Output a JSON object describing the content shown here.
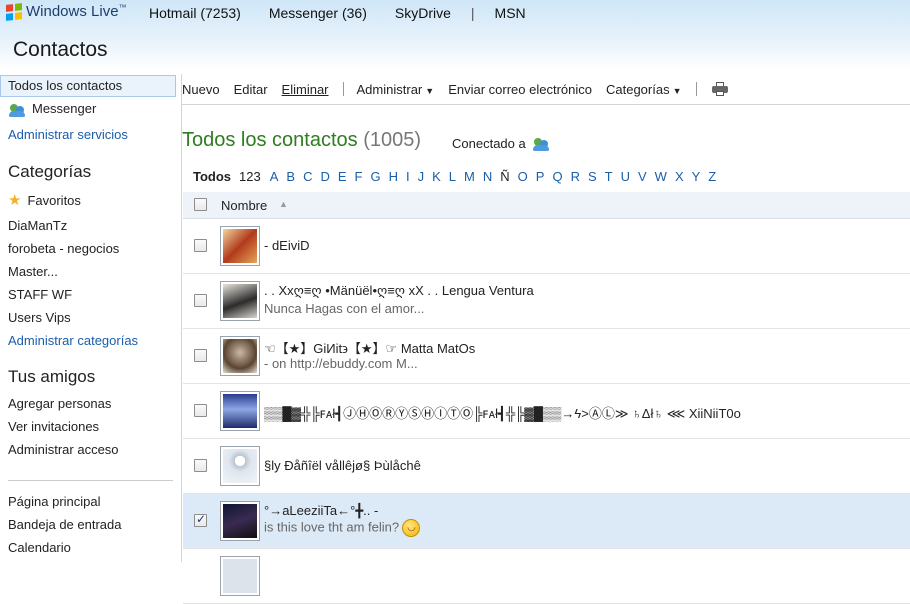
{
  "topbar": {
    "brand": "Windows Live",
    "brand_mark": "™",
    "nav": [
      "Hotmail (7253)",
      "Messenger (36)",
      "SkyDrive"
    ],
    "nav_sep": "|",
    "nav_last": "MSN",
    "flag_colors": [
      "#e8452c",
      "#7cbb00",
      "#00a1f1",
      "#ffbb00"
    ]
  },
  "page_title": "Contactos",
  "sidebar": {
    "all_contacts": "Todos los contactos",
    "messenger": "Messenger",
    "manage_services": "Administrar servicios",
    "categories_head": "Categorías",
    "favorites": "Favoritos",
    "categories": [
      "DiaManTz",
      "forobeta - negocios",
      "Master...",
      "STAFF WF",
      "Users Vips"
    ],
    "manage_categories": "Administrar categorías",
    "friends_head": "Tus amigos",
    "add_people": "Agregar personas",
    "view_invites": "Ver invitaciones",
    "manage_access": "Administrar acceso",
    "home": "Página principal",
    "inbox": "Bandeja de entrada",
    "calendar": "Calendario"
  },
  "toolbar": {
    "new": "Nuevo",
    "edit": "Editar",
    "delete": "Eliminar",
    "manage": "Administrar",
    "send_email": "Enviar correo electrónico",
    "categories": "Categorías",
    "print_icon": "printer-icon"
  },
  "heading": {
    "title": "Todos los contactos",
    "count": "(1005)",
    "connected": "Conectado a"
  },
  "alphabet": {
    "current": "Todos",
    "numbers": "123",
    "letters": [
      "A",
      "B",
      "C",
      "D",
      "E",
      "F",
      "G",
      "H",
      "I",
      "J",
      "K",
      "L",
      "M",
      "N",
      "Ñ",
      "O",
      "P",
      "Q",
      "R",
      "S",
      "T",
      "U",
      "V",
      "W",
      "X",
      "Y",
      "Z"
    ],
    "inactive": [
      "Ñ"
    ]
  },
  "list": {
    "header": "Nombre",
    "rows": [
      {
        "name": "- dEiviD",
        "message": "",
        "checked": false
      },
      {
        "name": ". . Xxღ≡ღ •Mänüël•ღ≡ღ xX . . Lengua Ventura",
        "message": "Nunca Hagas con el amor...",
        "checked": false
      },
      {
        "name": "☜【★】GiИit϶【★】☞ Matta MatOs",
        "message": "- on http://ebuddy.com M...",
        "checked": false
      },
      {
        "name": "▒▒█▓╬╠ꜰᴀł┫ⒿⒽⓄⓇⓎⓈⒽⒾⓉⓄ╠ꜰᴀł┫╬╠▓█▒▒→ϟ>ⒶⓁ≫ ♄Δł♄ ⋘ XiiNiiT0o",
        "message": "",
        "checked": false
      },
      {
        "name": "§ly Ðåñîël vållêjø§ Þùlåchê",
        "message": "",
        "checked": false
      },
      {
        "name": "°→aLeeziiTa←°╋.. -",
        "message": "is this love tht am felin?",
        "checked": true
      }
    ]
  }
}
